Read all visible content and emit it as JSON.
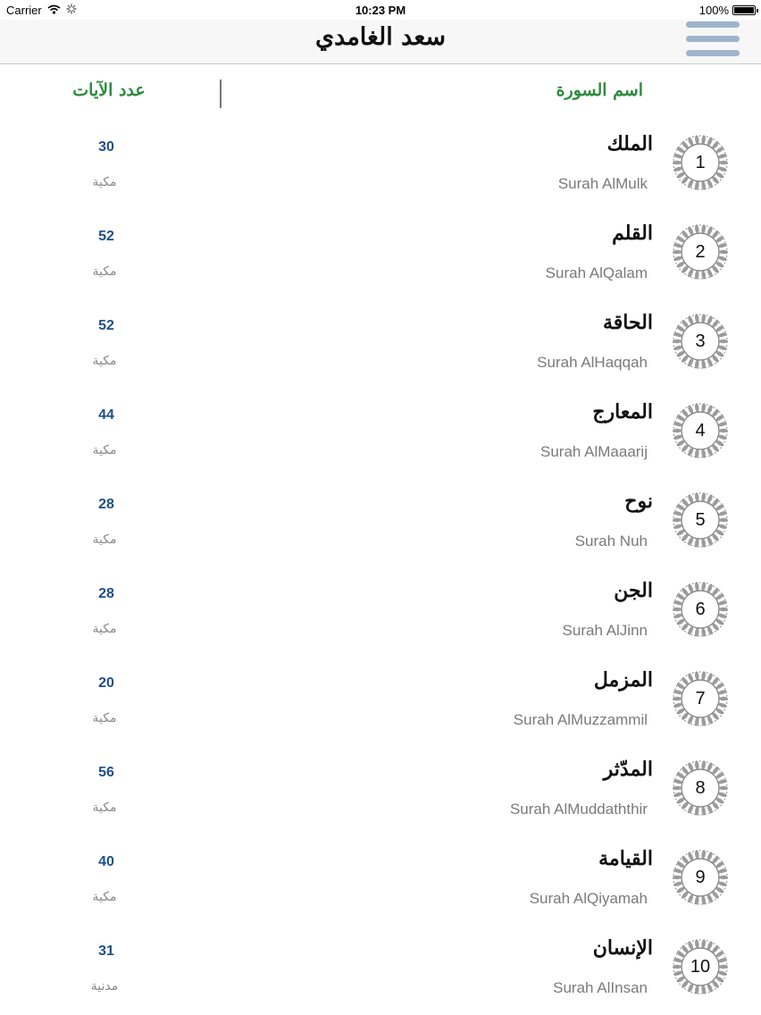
{
  "status_bar": {
    "carrier": "Carrier",
    "time": "10:23 PM",
    "battery": "100%",
    "battery_level": 1.0
  },
  "nav": {
    "title": "سعد الغامدي",
    "menu_icon": "hamburger-menu-icon",
    "menu_color": "#9fb4cc"
  },
  "header": {
    "verses_label": "عدد الآيات",
    "name_label": "اسم السورة",
    "label_color": "#2e8b3e"
  },
  "surahs": [
    {
      "number": "1",
      "arabic": "الملك",
      "english": "Surah AlMulk",
      "verses": "30",
      "type": "مكية"
    },
    {
      "number": "2",
      "arabic": "القلم",
      "english": "Surah AlQalam",
      "verses": "52",
      "type": "مكية"
    },
    {
      "number": "3",
      "arabic": "الحاقة",
      "english": "Surah AlHaqqah",
      "verses": "52",
      "type": "مكية"
    },
    {
      "number": "4",
      "arabic": "المعارج",
      "english": "Surah AlMaaarij",
      "verses": "44",
      "type": "مكية"
    },
    {
      "number": "5",
      "arabic": "نوح",
      "english": "Surah Nuh",
      "verses": "28",
      "type": "مكية"
    },
    {
      "number": "6",
      "arabic": "الجن",
      "english": "Surah AlJinn",
      "verses": "28",
      "type": "مكية"
    },
    {
      "number": "7",
      "arabic": "المزمل",
      "english": "Surah AlMuzzammil",
      "verses": "20",
      "type": "مكية"
    },
    {
      "number": "8",
      "arabic": "المدّثر",
      "english": "Surah AlMuddaththir",
      "verses": "56",
      "type": "مكية"
    },
    {
      "number": "9",
      "arabic": "القيامة",
      "english": "Surah AlQiyamah",
      "verses": "40",
      "type": "مكية"
    },
    {
      "number": "10",
      "arabic": "الإنسان",
      "english": "Surah AlInsan",
      "verses": "31",
      "type": "مدنية"
    }
  ],
  "colors": {
    "verse_count": "#1e4f8c",
    "english_name": "#7a7a7a",
    "badge_ornament": "#8a8a8a"
  }
}
